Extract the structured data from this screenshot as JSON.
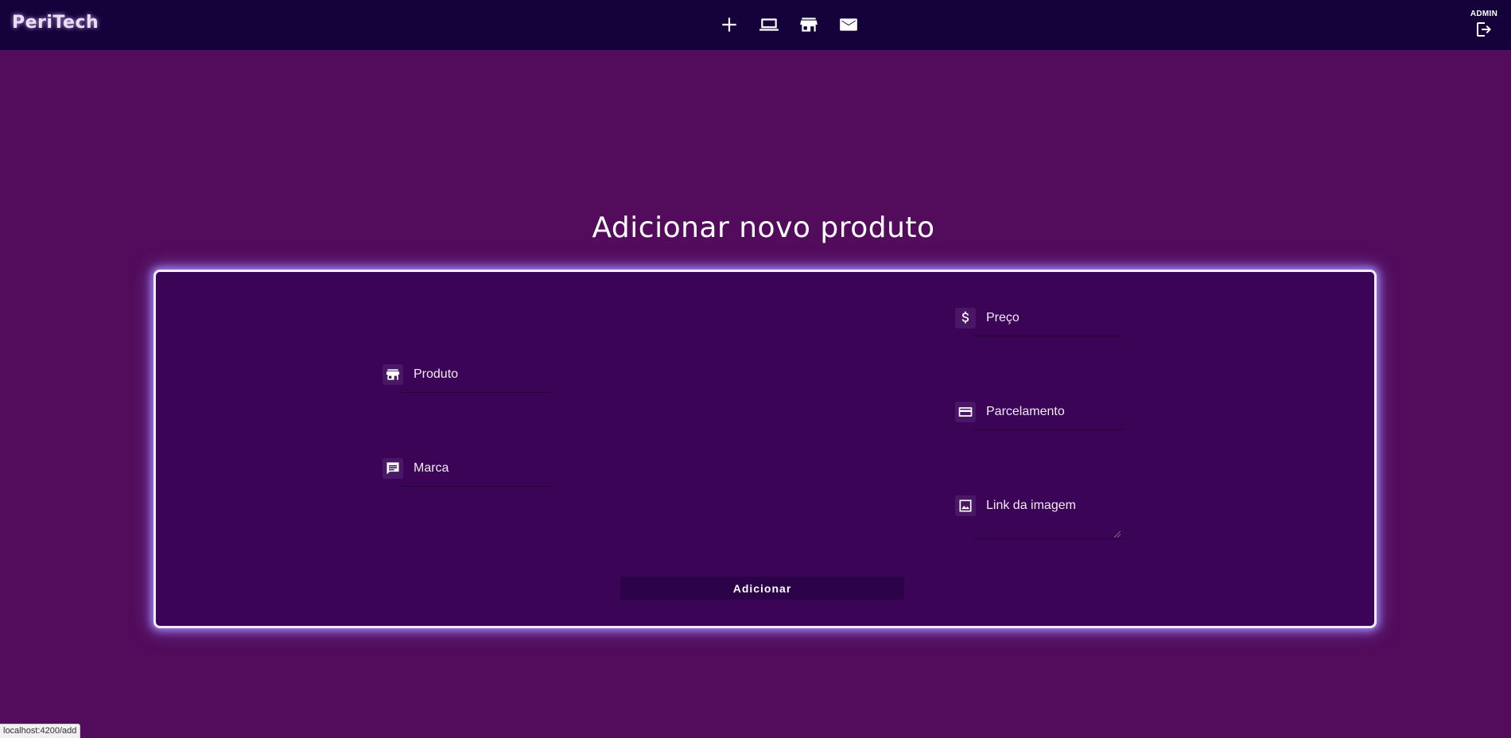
{
  "header": {
    "brand": "PeriTech",
    "nav_icons": [
      "add-icon",
      "laptop-icon",
      "store-icon",
      "mail-icon"
    ],
    "admin_label": "ADMIN",
    "logout_icon": "logout-icon"
  },
  "page": {
    "title": "Adicionar novo produto"
  },
  "form": {
    "produto_label": "Produto",
    "marca_label": "Marca",
    "preco_label": "Preço",
    "parcelamento_label": "Parcelamento",
    "imagem_label": "Link da imagem",
    "submit_label": "Adicionar"
  },
  "status_bar": {
    "url": "localhost:4200/add"
  },
  "colors": {
    "page_bg": "#520c5b",
    "topbar_bg": "#16023a",
    "card_bg": "#3b0456",
    "button_bg": "#2c0248",
    "glow": "#aa96ff"
  }
}
